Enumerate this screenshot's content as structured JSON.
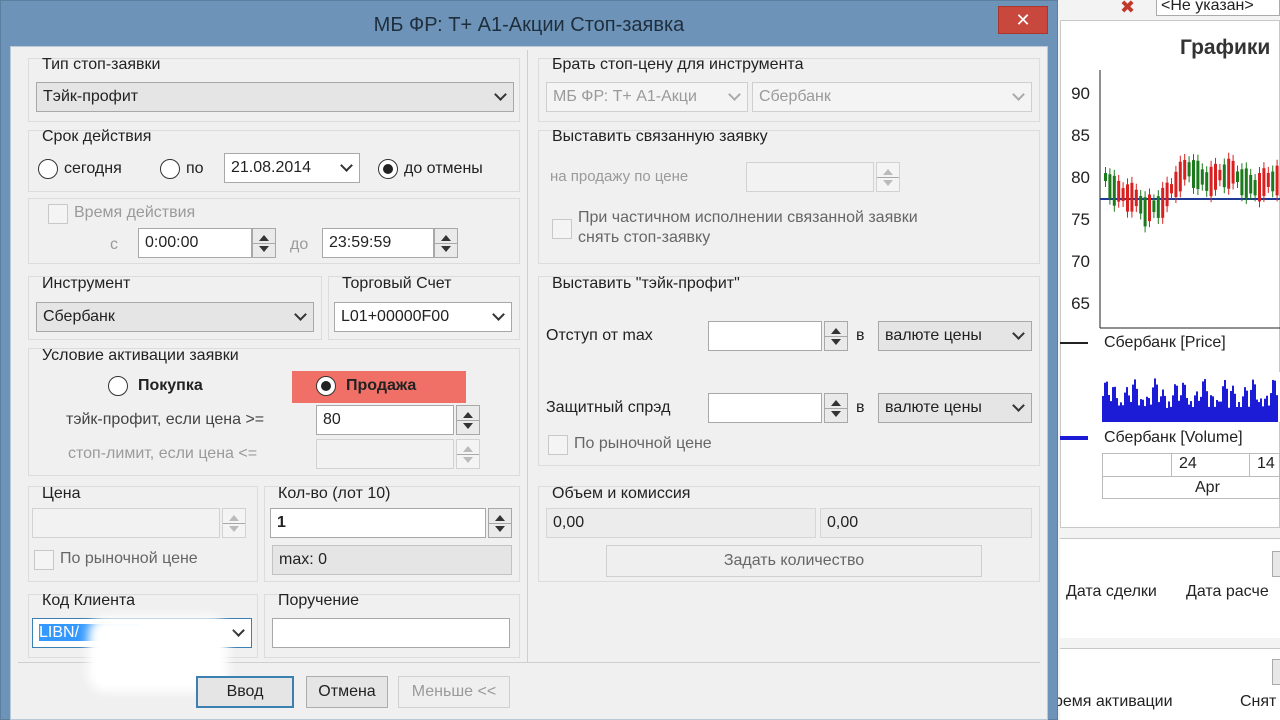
{
  "background_app": {
    "header_tail": "<Не указан>",
    "chart_title": "Графики",
    "y_ticks": [
      "90",
      "85",
      "80",
      "75",
      "70",
      "65"
    ],
    "price_legend": "Сбербанк [Price]",
    "volume_legend": "Сбербанк [Volume]",
    "date_top": [
      "24",
      "14"
    ],
    "date_month": "Apr",
    "trades_cols": [
      "Дата сделки",
      "Дата расче"
    ],
    "bottom_cols": [
      "ремя активации",
      "Снят"
    ],
    "colors": {
      "up": "#1b7a1b",
      "down": "#d92020",
      "volume": "#1c1cd6"
    }
  },
  "dialog": {
    "title": "МБ ФР: Т+ А1-Акции Стоп-заявка",
    "close": "✕",
    "title_bar_color": "#6d94b8"
  },
  "stop_type": {
    "label": "Тип стоп-заявки",
    "value": "Тэйк-профит"
  },
  "validity": {
    "label": "Срок действия",
    "today": "сегодня",
    "until": "по",
    "date": "21.08.2014",
    "until_cancel": "до отмены",
    "selected": "до отмены"
  },
  "time": {
    "label": "Время действия",
    "from_label": "с",
    "from": "0:00:00",
    "to_label": "до",
    "to": "23:59:59"
  },
  "instrument": {
    "label": "Инструмент",
    "value": "Сбербанк"
  },
  "account": {
    "label": "Торговый Счет",
    "value": "L01+00000F00"
  },
  "activation": {
    "label": "Условие активации заявки",
    "buy": "Покупка",
    "sell": "Продажа",
    "selected": "Продажа",
    "sell_highlight": "#f07067",
    "tp_label": "тэйк-профит, если цена >=",
    "tp_value": "80",
    "sl_label": "стоп-лимит, если цена <="
  },
  "price": {
    "label": "Цена",
    "market": "По рыночной цене"
  },
  "qty": {
    "label": "Кол-во (лот 10)",
    "value": "1",
    "max": "max: 0"
  },
  "client": {
    "label": "Код Клиента",
    "value": "LIBN/"
  },
  "order_note": {
    "label": "Поручение",
    "value": ""
  },
  "buttons": {
    "ok": "Ввод",
    "cancel": "Отмена",
    "less": "Меньше <<"
  },
  "right": {
    "stop_price_label": "Брать стоп-цену для инструмента",
    "stop_class": "МБ ФР: Т+ А1-Акци",
    "stop_instrument": "Сбербанк",
    "linked_label": "Выставить связанную заявку",
    "linked_price_label": "на продажу по цене",
    "linked_partial": "При частичном исполнении связанной заявки",
    "linked_partial2": "снять стоп-заявку",
    "tp_label": "Выставить \"тэйк-профит\"",
    "offset_label": "Отступ от max",
    "in_label": "в",
    "offset_unit": "валюте цены",
    "spread_label": "Защитный спрэд",
    "spread_unit": "валюте цены",
    "market": "По рыночной цене",
    "volume_label": "Объем и комиссия",
    "volume_value": "0,00",
    "commission_value": "0,00",
    "set_qty": "Задать количество"
  }
}
